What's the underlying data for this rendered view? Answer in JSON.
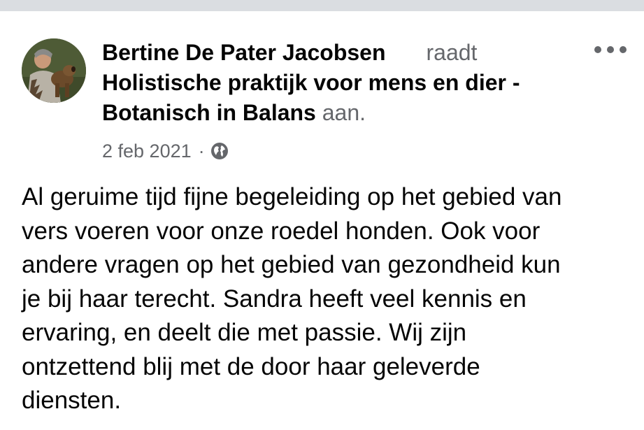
{
  "post": {
    "author": "Bertine De Pater Jacobsen",
    "verb": "raadt",
    "page_name_line1": "Holistische praktijk voor mens en dier -",
    "page_name_line2": "Botanisch in Balans",
    "suffix": " aan.",
    "date": "2 feb 2021",
    "separator": "·",
    "privacy_icon": "globe-icon",
    "more_icon": "more-options-icon",
    "body_lines": [
      "Al geruime tijd fijne begeleiding op het gebied van",
      "vers voeren voor onze roedel honden. Ook voor",
      "andere vragen op het gebied van gezondheid kun",
      "je bij haar terecht. Sandra heeft veel kennis en",
      "ervaring, en deelt die met passie. Wij zijn",
      "ontzettend blij met de door haar geleverde",
      "diensten."
    ]
  },
  "colors": {
    "text_primary": "#050505",
    "text_secondary": "#65676b",
    "top_bar": "#dadde1"
  }
}
